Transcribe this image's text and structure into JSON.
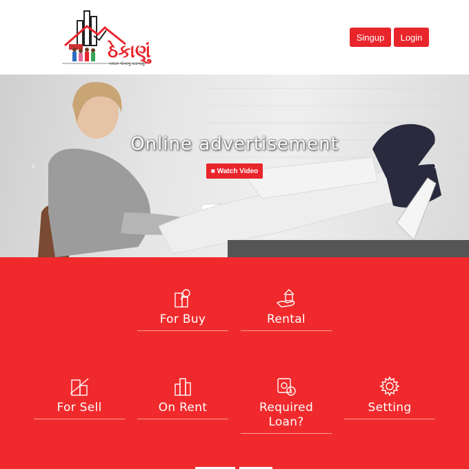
{
  "header": {
    "logo_text": "ઠેકાણું",
    "logo_tagline": "તમારું પોતાનું સરનામું",
    "signup_label": "Singup",
    "login_label": "Login"
  },
  "hero": {
    "title": "Online advertisement",
    "cta_label": "Watch Video",
    "prev_arrow": "‹",
    "next_arrow": "›"
  },
  "services": {
    "items": [
      {
        "label": "For Buy",
        "icon": "buildings-search-icon"
      },
      {
        "label": "Rental",
        "icon": "house-hand-icon"
      },
      {
        "label": "For Sell",
        "icon": "building-sold-icon"
      },
      {
        "label": "On Rent",
        "icon": "city-buildings-icon"
      },
      {
        "label": "Required Loan?",
        "icon": "money-icon"
      },
      {
        "label": "Setting",
        "icon": "gear-icon"
      }
    ]
  },
  "colors": {
    "brand_red": "#e8252b",
    "services_bg": "#f02a2c"
  }
}
